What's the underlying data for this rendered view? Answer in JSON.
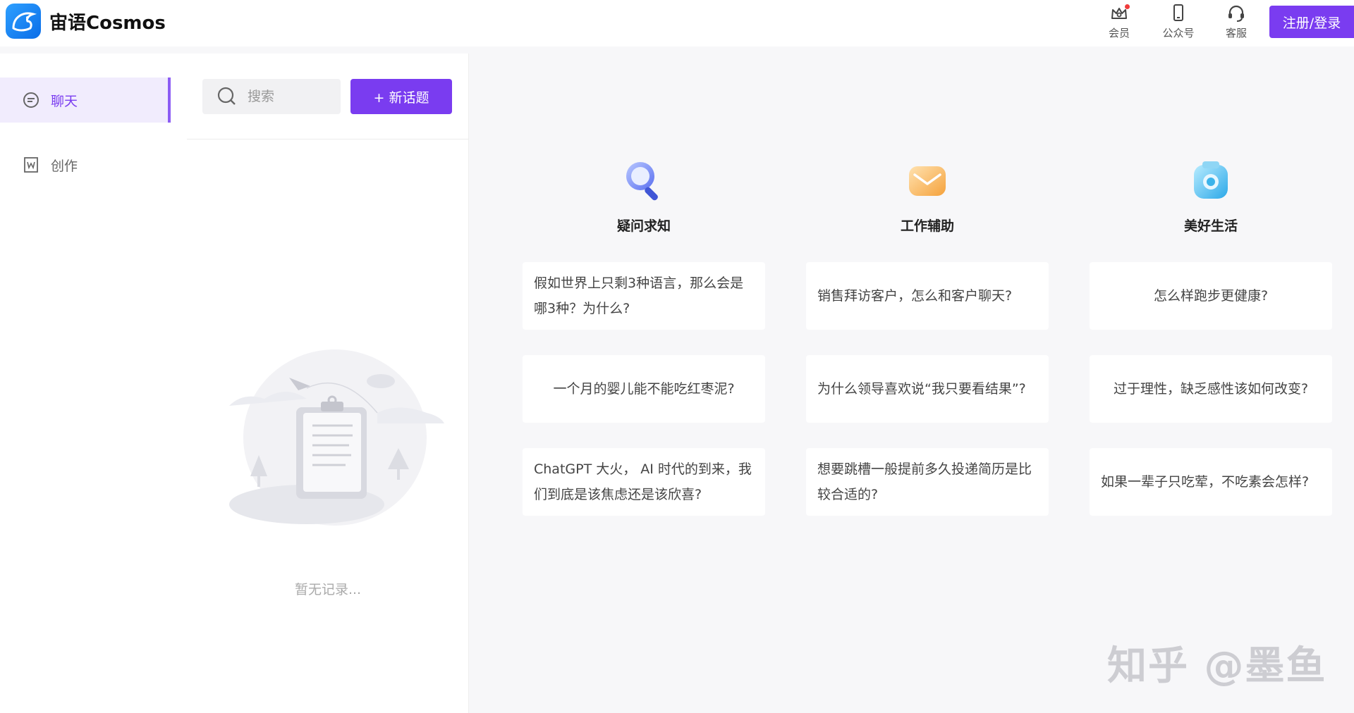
{
  "header": {
    "brand": "宙语Cosmos",
    "member_label": "会员",
    "official_label": "公众号",
    "service_label": "客服",
    "login_label": "注册/登录"
  },
  "nav": {
    "items": [
      {
        "label": "聊天",
        "icon": "chat-icon",
        "active": true
      },
      {
        "label": "创作",
        "icon": "word-doc-icon",
        "active": false
      }
    ]
  },
  "middle": {
    "search_placeholder": "搜索",
    "new_topic_label": "+ 新话题",
    "empty_text": "暂无记录..."
  },
  "categories": [
    {
      "title": "疑问求知",
      "icon": "magnifier-icon",
      "cards": [
        "假如世界上只剩3种语言，那么会是哪3种？为什么?",
        "一个月的婴儿能不能吃红枣泥?",
        "ChatGPT 大火， AI 时代的到来，我们到底是该焦虑还是该欣喜?"
      ]
    },
    {
      "title": "工作辅助",
      "icon": "mail-icon",
      "cards": [
        "销售拜访客户，怎么和客户聊天?",
        "为什么领导喜欢说“我只要看结果”?",
        "想要跳槽一般提前多久投递简历是比较合适的?"
      ]
    },
    {
      "title": "美好生活",
      "icon": "camera-icon",
      "cards": [
        "怎么样跑步更健康?",
        "过于理性，缺乏感性该如何改变?",
        "如果一辈子只吃荤，不吃素会怎样?"
      ]
    }
  ],
  "watermark": "知乎 @墨鱼",
  "colors": {
    "accent": "#7a3cf0",
    "active_bg": "#f1ecfd",
    "brand_blue": "#1677ff"
  }
}
